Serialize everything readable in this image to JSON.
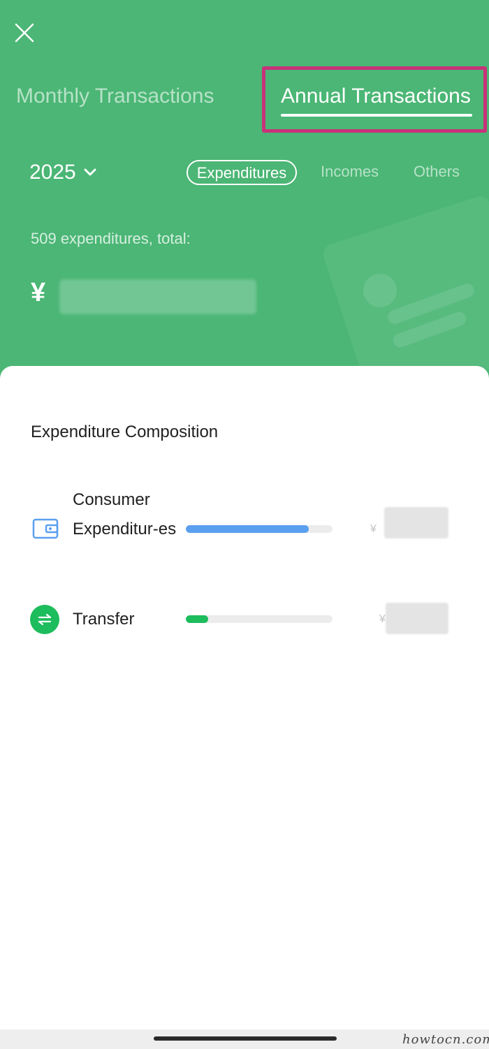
{
  "header": {
    "tabs": [
      {
        "label": "Monthly Transactions",
        "active": false
      },
      {
        "label": "Annual Transactions",
        "active": true
      }
    ],
    "year": "2025",
    "filters": [
      {
        "label": "Expenditures",
        "selected": true
      },
      {
        "label": "Incomes",
        "selected": false
      },
      {
        "label": "Others",
        "selected": false
      }
    ],
    "summary_text": "509 expenditures, total:",
    "currency_symbol": "¥",
    "colors": {
      "background": "#4bb675",
      "highlight_box": "#c8327a"
    }
  },
  "composition": {
    "title": "Expenditure Composition",
    "items": [
      {
        "label": "Consumer Expenditur-es",
        "icon": "wallet-icon",
        "bar_fraction": 0.84,
        "bar_color": "#5a9ff0",
        "currency_symbol": "¥"
      },
      {
        "label": "Transfer",
        "icon": "transfer-icon",
        "bar_fraction": 0.15,
        "bar_color": "#1dbc5c",
        "currency_symbol": "¥"
      }
    ]
  },
  "watermark": "howtocn.com"
}
